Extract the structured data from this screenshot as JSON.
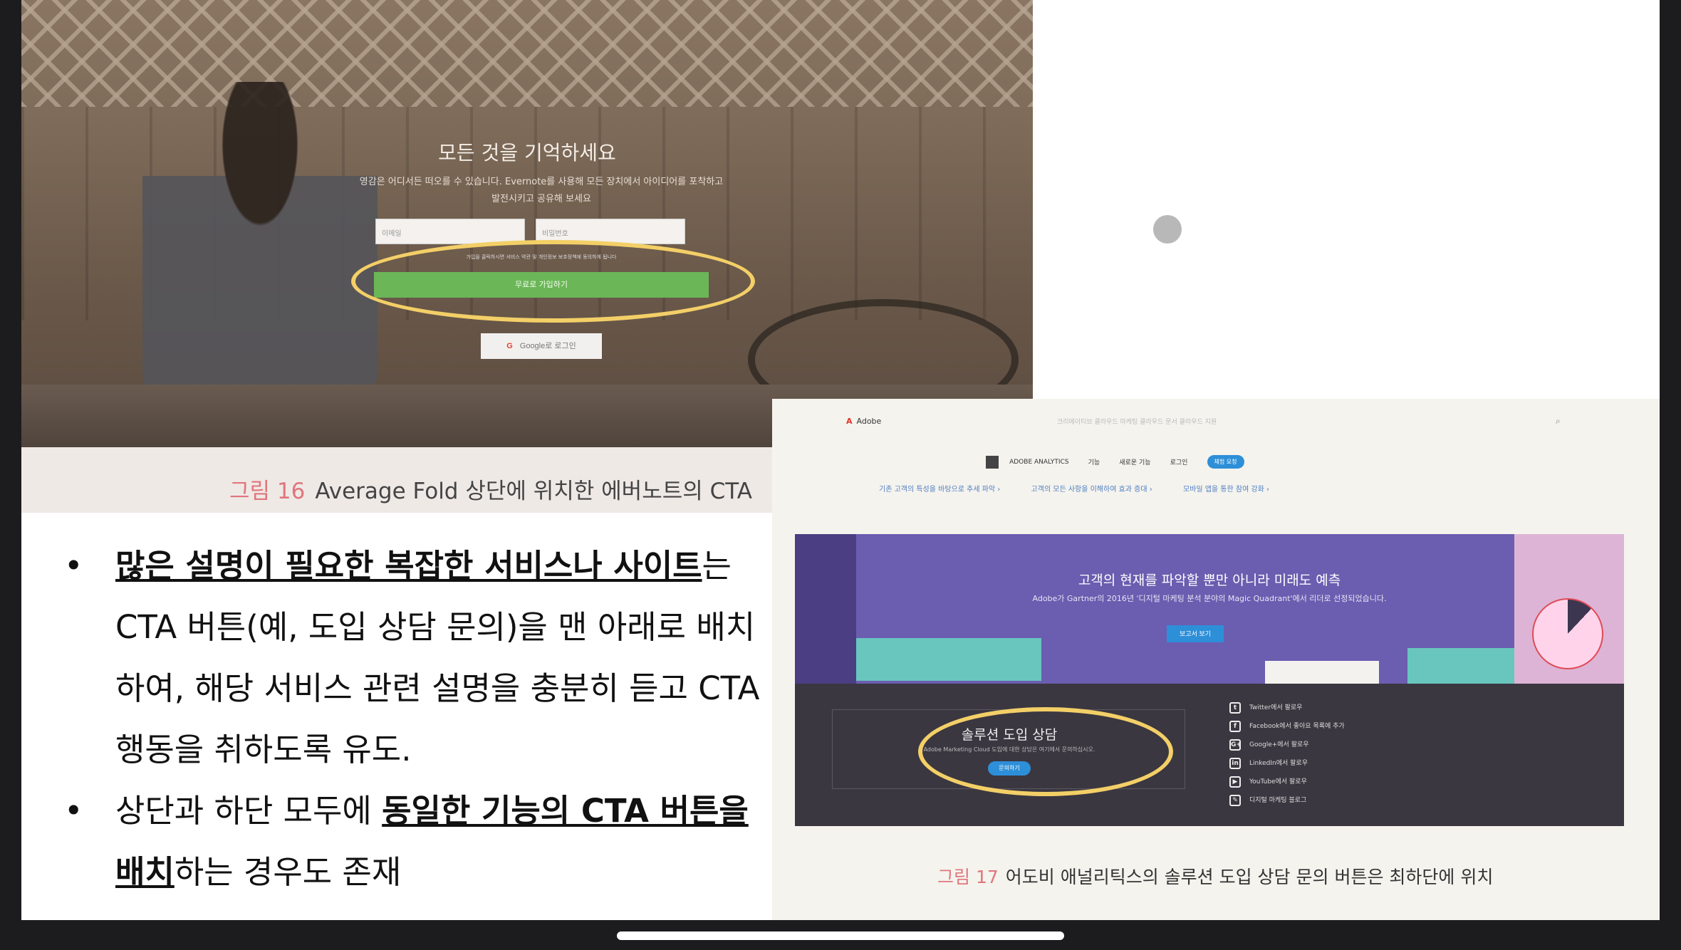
{
  "fig16": {
    "hero_title": "모든 것을 기억하세요",
    "hero_sub": "영감은 어디서든 떠오를 수 있습니다. Evernote를 사용해 모든 장치에서 아이디어를 포착하고 발전시키고 공유해 보세요",
    "email_placeholder": "이메일",
    "password_placeholder": "비밀번호",
    "terms": "가입을 클릭하시면 서비스 약관 및 개인정보 보호정책에 동의하게 됩니다",
    "signup_label": "무료로 가입하기",
    "google_label": "Google로 로그인",
    "caption_num": "그림 16",
    "caption_text": "Average Fold 상단에 위치한 에버노트의 CTA"
  },
  "bullets": [
    {
      "bold": "많은 설명이 필요한 복잡한 서비스나 사이트",
      "text": "는 CTA 버튼(예, 도입 상담 문의)을 맨 아래로 배치하여, 해당 서비스 관련 설명을 충분히 듣고 CTA 행동을 취하도록 유도."
    },
    {
      "pre": "상단과 하단 모두에 ",
      "bold": "동일한 기능의 CTA 버튼을 배치",
      "text": "하는 경우도 존재"
    }
  ],
  "fig17": {
    "logo": "Adobe",
    "menu": "크리에이티브 클라우드   마케팅 클라우드   문서 클라우드   지원",
    "product": "ADOBE ANALYTICS",
    "subnav": [
      "기능",
      "새로운 기능",
      "로그인"
    ],
    "trial": "체험 요청",
    "links": [
      "기존 고객의 특성을 바탕으로 추세 파악 ›",
      "고객의 모든 사항을 이해하여 효과 증대 ›",
      "모바일 앱을 통한 참여 강화 ›"
    ],
    "banner_title": "고객의 현재를 파악할 뿐만 아니라 미래도 예측",
    "banner_sub": "Adobe가 Gartner의 2016년 '디지털 마케팅 분석 분야의 Magic Quadrant'에서 리더로 선정되었습니다.",
    "banner_btn": "보고서 보기",
    "solution_title": "솔루션 도입 상담",
    "solution_sub": "Adobe Marketing Cloud 도입에 대한 상담은 여기에서 문의하십시오.",
    "solution_btn": "문의하기",
    "social": [
      {
        "icon": "t",
        "label": "Twitter에서 팔로우"
      },
      {
        "icon": "f",
        "label": "Facebook에서 좋아요 목록에 추가"
      },
      {
        "icon": "G+",
        "label": "Google+에서 팔로우"
      },
      {
        "icon": "in",
        "label": "LinkedIn에서 팔로우"
      },
      {
        "icon": "▶",
        "label": "YouTube에서 팔로우"
      },
      {
        "icon": "✎",
        "label": "디지털 마케팅 블로그"
      }
    ],
    "caption_num": "그림 17",
    "caption_text": "어도비 애널리틱스의 솔루션 도입 상담 문의 버튼은 최하단에 위치"
  },
  "colors": {
    "highlight": "#f3cf67",
    "caption_num": "#e0767c",
    "evernote_green": "#6bb657",
    "adobe_blue": "#2d8fd8",
    "adobe_red": "#e4312b"
  }
}
